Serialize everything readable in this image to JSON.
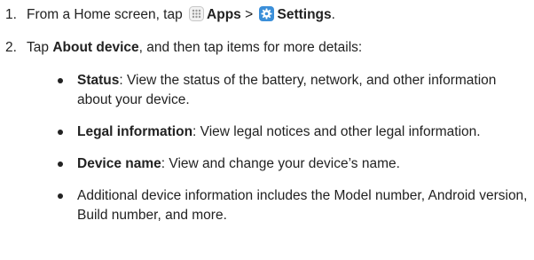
{
  "steps": [
    {
      "number": "1.",
      "text_before": "From a Home screen, tap",
      "apps_icon": "apps-grid-icon",
      "apps_label": "Apps",
      "separator": ">",
      "settings_icon": "settings-gear-icon",
      "settings_label": "Settings",
      "end": "."
    },
    {
      "number": "2.",
      "text_before": "Tap",
      "bold": "About device",
      "text_after": ", and then tap items for more details:"
    }
  ],
  "bullets": [
    {
      "bold": "Status",
      "text": ": View the status of the battery, network, and other information about your device."
    },
    {
      "bold": "Legal information",
      "text": ": View legal notices and other legal information."
    },
    {
      "bold": "Device name",
      "text": ": View and change your device’s name."
    },
    {
      "bold": "",
      "text": "Additional device information includes the Model number, Android version, Build number, and more."
    }
  ],
  "colors": {
    "settings_icon_bg": "#3b8fd9",
    "apps_icon_dots": "#9a9a9a",
    "text": "#222222"
  }
}
